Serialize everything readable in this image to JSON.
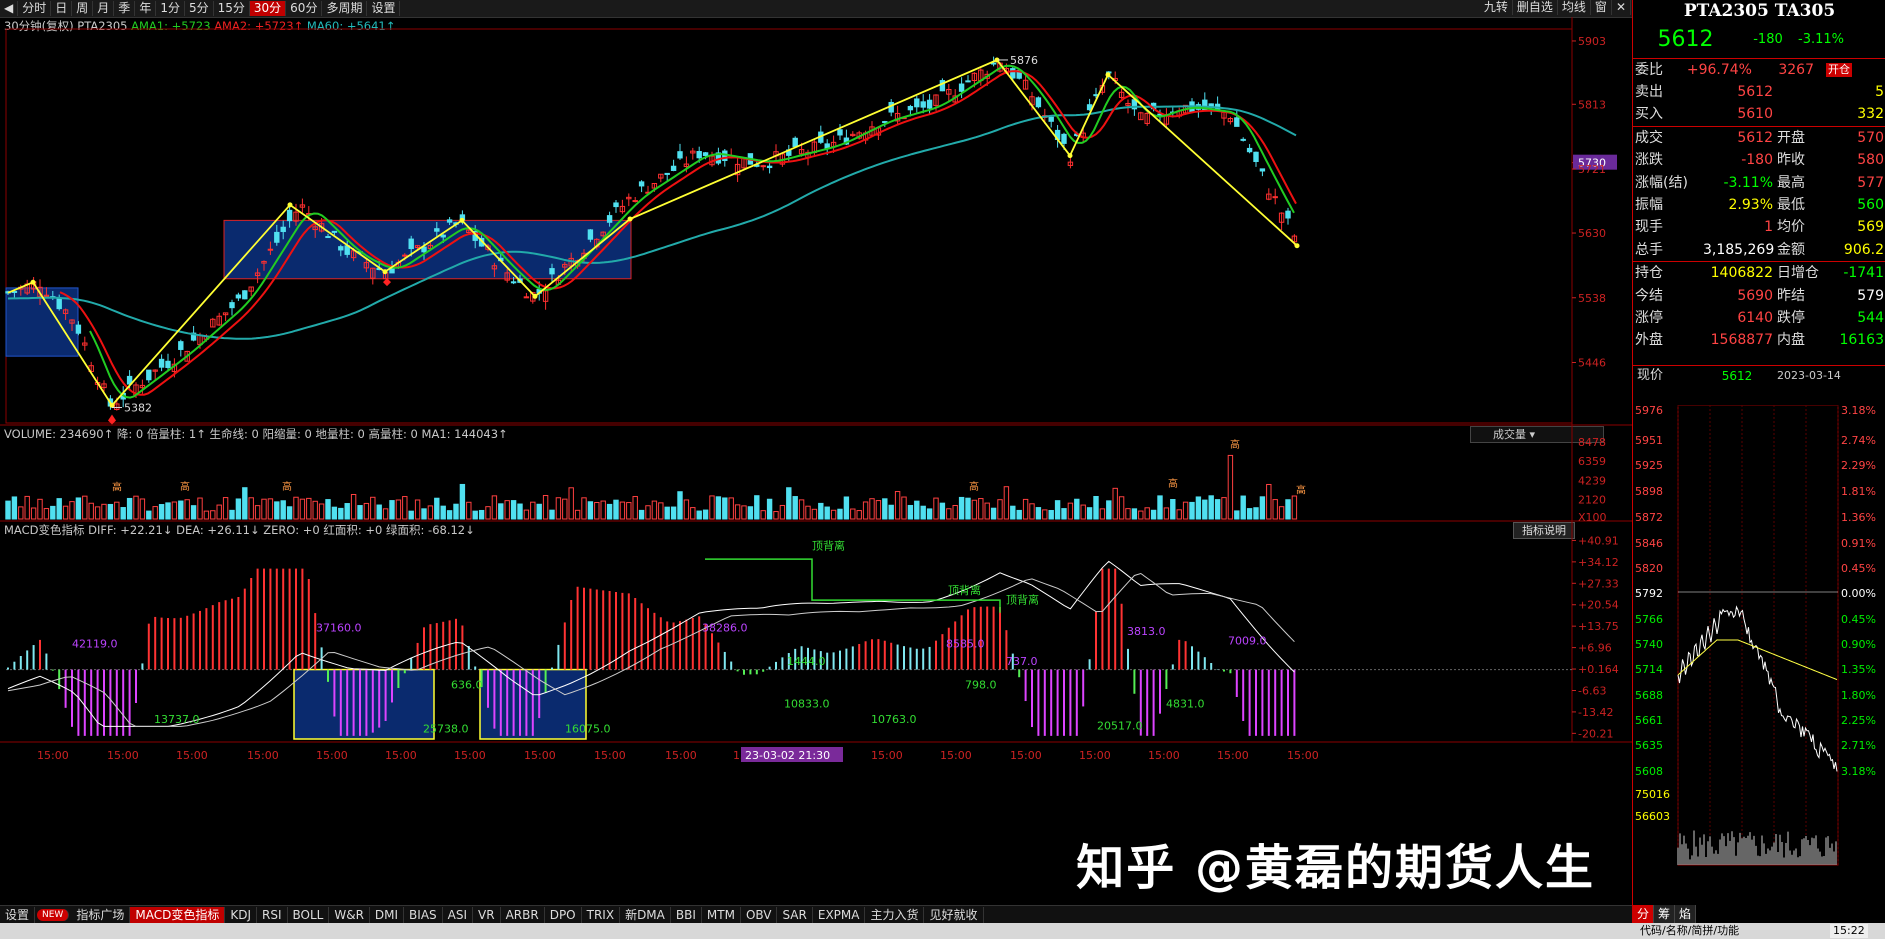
{
  "topbar": {
    "tabs": [
      "分时",
      "日",
      "周",
      "月",
      "季",
      "年",
      "1分",
      "5分",
      "15分",
      "30分",
      "60分",
      "多周期",
      "设置"
    ],
    "active_tab": "30分",
    "right_tools": [
      "九转",
      "删自选",
      "均线",
      "窗",
      "✕"
    ]
  },
  "main_chart": {
    "legend_label": "30分钟(复权)",
    "symbol": "PTA2305",
    "ama1": "AMA1: +5723",
    "ama2": "AMA2: +5723↑",
    "ma60": "MA60: +5641↑",
    "y_labels": [
      "5903",
      "5813",
      "5730",
      "5721",
      "5630",
      "5538",
      "5446"
    ],
    "high_label": "5876",
    "low_label": "5382",
    "colors": {
      "ama1": "#22cc22",
      "ama2": "#ee1111",
      "ma60": "#22aaaa",
      "zigzag": "#ffff33"
    }
  },
  "volume_chart": {
    "legend": "VOLUME: 234690↑ 降: 0 倍量柱: 1↑ 生命线: 0 阳缩量: 0 地量柱: 0 高量柱: 0 MA1: 144043↑",
    "dropdown": "成交量",
    "y_labels": [
      "8478",
      "6359",
      "4239",
      "2120",
      "X100"
    ],
    "gao_marker": "高"
  },
  "macd_chart": {
    "legend": "MACD变色指标 DIFF: +22.21↓ DEA: +26.11↓ ZERO: +0 红面积: +0 绿面积: -68.12↓",
    "button": "指标说明",
    "y_labels": [
      "+40.91",
      "+34.12",
      "+27.33",
      "+20.54",
      "+13.75",
      "+6.96",
      "+0.164",
      "-6.63",
      "-13.42",
      "-20.21"
    ],
    "area_labels": [
      "42119.0",
      "13737.0",
      "37160.0",
      "25738.0",
      "636.0",
      "38286.0",
      "1444.0",
      "10833.0",
      "10763.0",
      "8585.0",
      "798.0",
      "737.0",
      "20517.0",
      "3813.0",
      "4831.0",
      "7009.0",
      "16075.0"
    ],
    "divergence_labels": [
      "顶背离",
      "顶背离",
      "顶背离"
    ]
  },
  "time_axis": {
    "labels": [
      "15:00",
      "15:00",
      "15:00",
      "15:00",
      "15:00",
      "15:00",
      "15:00",
      "15:00",
      "15:00",
      "15:00",
      "15:00",
      "15:00",
      "15:00",
      "15:00",
      "15:00",
      "15:00",
      "15:00",
      "15:00",
      "15:00"
    ],
    "cursor_label": "23-03-02 21:30"
  },
  "bottombar": {
    "items": [
      "设置",
      "NEW",
      "指标广场",
      "MACD变色指标",
      "KDJ",
      "RSI",
      "BOLL",
      "W&R",
      "DMI",
      "BIAS",
      "ASI",
      "VR",
      "ARBR",
      "DPO",
      "TRIX",
      "新DMA",
      "BBI",
      "MTM",
      "OBV",
      "SAR",
      "EXPMA",
      "主力入货",
      "见好就收"
    ],
    "active": "MACD变色指标"
  },
  "side": {
    "title": "PTA2305 TA305",
    "price": "5612",
    "change": "-180",
    "change_pct": "-3.11%",
    "weibi_label": "委比",
    "weibi": "+96.74%",
    "weicha": "3267",
    "kaiping": "开仓",
    "rows": [
      {
        "l1": "卖出",
        "v1": "5612",
        "v1c": "#ff4444",
        "l2": "",
        "v2": "5",
        "v2c": "#ffff00"
      },
      {
        "l1": "买入",
        "v1": "5610",
        "v1c": "#ff4444",
        "l2": "",
        "v2": "332",
        "v2c": "#ffff00"
      },
      {
        "l1": "成交",
        "v1": "5612",
        "v1c": "#ff4444",
        "l2": "开盘",
        "v2": "570",
        "v2c": "#ff4444"
      },
      {
        "l1": "涨跌",
        "v1": "-180",
        "v1c": "#ff4444",
        "l2": "昨收",
        "v2": "580",
        "v2c": "#ff4444"
      },
      {
        "l1": "涨幅(结)",
        "v1": "-3.11%",
        "v1c": "#00ff00",
        "l2": "最高",
        "v2": "577",
        "v2c": "#ff4444"
      },
      {
        "l1": "振幅",
        "v1": "2.93%",
        "v1c": "#ffff00",
        "l2": "最低",
        "v2": "560",
        "v2c": "#00ff00"
      },
      {
        "l1": "现手",
        "v1": "1",
        "v1c": "#ff4444",
        "l2": "均价",
        "v2": "569",
        "v2c": "#ffff00"
      },
      {
        "l1": "总手",
        "v1": "3,185,269",
        "v1c": "#ffffff",
        "l2": "金额",
        "v2": "906.2",
        "v2c": "#ffff00"
      },
      {
        "l1": "持仓",
        "v1": "1406822",
        "v1c": "#ffff00",
        "l2": "日增仓",
        "v2": "-1741",
        "v2c": "#00ff00"
      },
      {
        "l1": "今结",
        "v1": "5690",
        "v1c": "#ff4444",
        "l2": "昨结",
        "v2": "579",
        "v2c": "#ffffff"
      },
      {
        "l1": "涨停",
        "v1": "6140",
        "v1c": "#ff4444",
        "l2": "跌停",
        "v2": "544",
        "v2c": "#00ff00"
      },
      {
        "l1": "外盘",
        "v1": "1568877",
        "v1c": "#ff4444",
        "l2": "内盘",
        "v2": "16163",
        "v2c": "#00ff00"
      }
    ],
    "now_label": "现价",
    "now_price": "5612",
    "now_time": "2023-03-14",
    "mini_left": [
      "5976",
      "5951",
      "5925",
      "5898",
      "5872",
      "5846",
      "5820",
      "5792",
      "5766",
      "5740",
      "5714",
      "5688",
      "5661",
      "5635",
      "5608",
      "75016",
      "56603"
    ],
    "mini_right": [
      "3.18%",
      "2.74%",
      "2.29%",
      "1.81%",
      "1.36%",
      "0.91%",
      "0.45%",
      "0.00%",
      "0.45%",
      "0.90%",
      "1.35%",
      "1.80%",
      "2.25%",
      "2.71%",
      "3.18%"
    ],
    "bottom_tabs": [
      "分",
      "筹",
      "焰"
    ],
    "status_text": "代码/名称/简拼/功能",
    "clock": "15:22"
  },
  "watermark": "知乎 @黄磊的期货人生"
}
